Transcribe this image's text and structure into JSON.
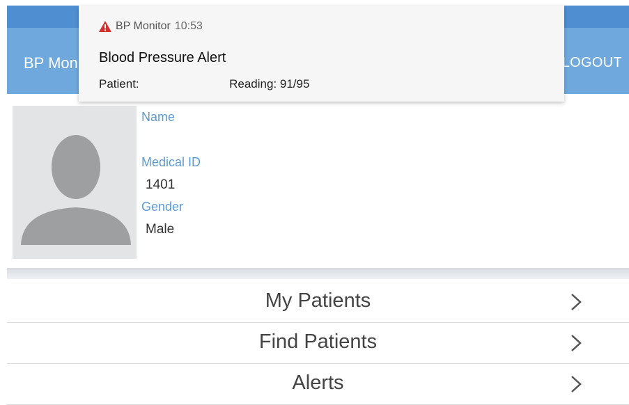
{
  "app_bar": {
    "title": "BP Monitor",
    "logout_label": "LOGOUT"
  },
  "notification": {
    "app_name": "BP Monitor",
    "time": "10:53",
    "title": "Blood Pressure Alert",
    "patient_label": "Patient:",
    "reading_label": "Reading: 91/95",
    "icon": "warning-icon",
    "icon_color": "#d32f2f"
  },
  "profile": {
    "name_label": "Name",
    "name_value": "",
    "medical_id_label": "Medical ID",
    "medical_id_value": "1401",
    "gender_label": "Gender",
    "gender_value": "Male"
  },
  "menu": {
    "items": [
      {
        "label": "My Patients",
        "icon": "chevron-right-icon"
      },
      {
        "label": "Find Patients",
        "icon": "chevron-right-icon"
      },
      {
        "label": "Alerts",
        "icon": "chevron-right-icon"
      }
    ]
  },
  "colors": {
    "app_bar": "#6fa8dc",
    "label_blue": "#5b9bd5"
  }
}
